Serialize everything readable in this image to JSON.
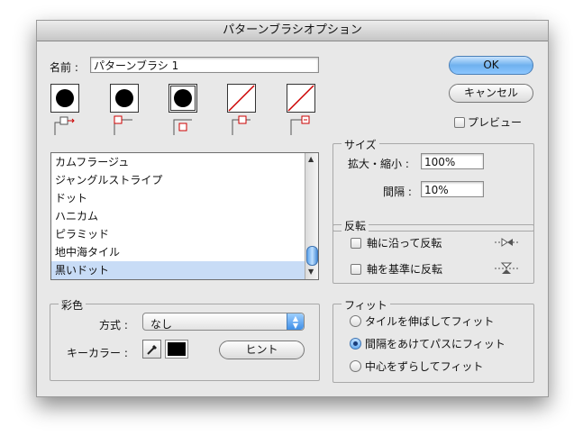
{
  "dialog": {
    "title": "パターンブラシオプション"
  },
  "name": {
    "label": "名前 :",
    "value": "パターンブラシ 1"
  },
  "buttons": {
    "ok": "OK",
    "cancel": "キャンセル",
    "hint": "ヒント"
  },
  "preview": {
    "label": "プレビュー",
    "checked": false
  },
  "pattern_list": {
    "items": [
      "カムフラージュ",
      "ジャングルストライプ",
      "ドット",
      "ハニカム",
      "ピラミッド",
      "地中海タイル",
      "黒いドット"
    ],
    "selected_index": 6
  },
  "size": {
    "title": "サイズ",
    "scale_label": "拡大・縮小 :",
    "scale_value": "100%",
    "spacing_label": "間隔 :",
    "spacing_value": "10%"
  },
  "flip": {
    "title": "反転",
    "along_label": "軸に沿って反転",
    "along_checked": false,
    "across_label": "軸を基準に反転",
    "across_checked": false
  },
  "colorization": {
    "title": "彩色",
    "method_label": "方式 :",
    "method_value": "なし",
    "keycolor_label": "キーカラー :",
    "keycolor": "#000000"
  },
  "fit": {
    "title": "フィット",
    "options": [
      "タイルを伸ばしてフィット",
      "間隔をあけてパスにフィット",
      "中心をずらしてフィット"
    ],
    "selected_index": 1
  },
  "colors": {
    "accent": "#6fb1ee",
    "selection": "#c8dcf6",
    "slash": "#cc0000"
  }
}
